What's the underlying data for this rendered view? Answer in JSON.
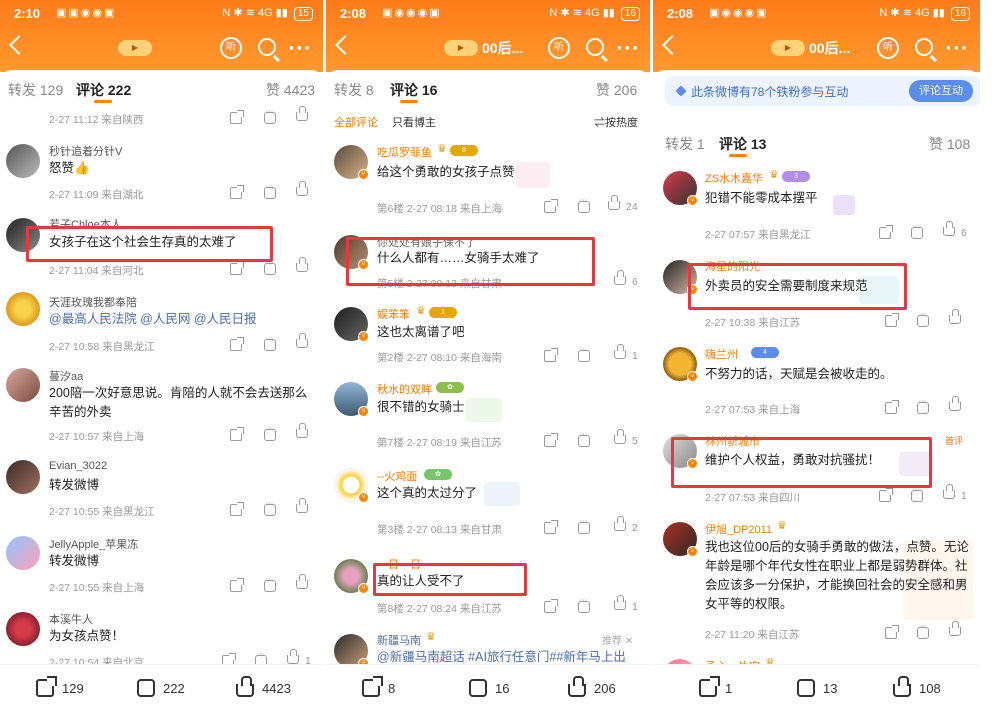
{
  "panels": [
    {
      "status": {
        "time": "2:10",
        "battery": "15"
      },
      "topic": "",
      "tabs": {
        "repost": "转发 129",
        "comments": "评论 222",
        "likes": "赞 4423"
      },
      "comments": [
        {
          "meta": "2-27 11:12  来自陕西"
        },
        {
          "user": "秒针追着分针V",
          "text": "怒赞👍",
          "meta": "2-27 11:09  来自湖北"
        },
        {
          "user": "若子Chloe本人",
          "text": "女孩子在这个社会生存真的太难了",
          "meta": "2-27 11:04  来自河北"
        },
        {
          "user": "天涯玫瑰我都奉陪",
          "text": "@最高人民法院 @人民网 @人民日报",
          "meta": "2-27 10:58  来自黑龙江"
        },
        {
          "user": "蔓汐aa",
          "text": "200陪一次好意思说。肯陪的人就不会去送那么辛苦的外卖",
          "meta": "2-27 10:57  来自上海"
        },
        {
          "user": "Evian_3022",
          "text": "转发微博",
          "meta": "2-27 10:55  来自黑龙江"
        },
        {
          "user": "JellyApple_苹果冻",
          "text": "转发微博",
          "meta": "2-27 10:55  来自上海"
        },
        {
          "user": "本溪牛人",
          "text": "为女孩点赞！",
          "meta": "2-27 10:54  来自北京",
          "likes": "1"
        }
      ],
      "bottom": {
        "share": "129",
        "comment": "222",
        "like": "4423"
      }
    },
    {
      "status": {
        "time": "2:08",
        "battery": "16"
      },
      "topic": "00后...",
      "tabs": {
        "repost": "转发 8",
        "comments": "评论 16",
        "likes": "赞 206"
      },
      "filters": {
        "all": "全部评论",
        "author": "只看博主",
        "sort": "按热度"
      },
      "comments": [
        {
          "user": "吃瓜罗菲鱼",
          "text": "给这个勇敢的女孩子点赞",
          "meta": "第6楼  2-27 08:18  来自上海",
          "likes": "24"
        },
        {
          "user": "你处处有娘子保不了",
          "text": "什么人都有……女骑手太难了",
          "meta": "第5楼  2-27 08:13  来自甘肃",
          "likes": "6"
        },
        {
          "user": "娱笨笨",
          "text": "这也太离谱了吧",
          "meta": "第2楼  2-27 08:10  来自海南",
          "likes": "1"
        },
        {
          "user": "秋水的双眸",
          "text": "很不错的女骑士",
          "meta": "第7楼  2-27 08:19  来自江苏",
          "likes": "5"
        },
        {
          "user": "--火鸡面",
          "text": "这个真的太过分了",
          "meta": "第3楼  2-27 08:13  来自甘肃",
          "likes": "2"
        },
        {
          "user": "一日一日",
          "text": "真的让人受不了",
          "meta": "第8楼  2-27 08:24  来自江苏",
          "likes": "1"
        },
        {
          "user": "新疆马南",
          "text": "@新疆马南超话 #AI旅行任意门##新年马上出发##我的家乡是强宝利##只需一张照片",
          "recommend": "推荐 ✕"
        }
      ],
      "bottom": {
        "share": "8",
        "comment": "16",
        "like": "206"
      }
    },
    {
      "status": {
        "time": "2:08",
        "battery": "16"
      },
      "topic": "00后...",
      "banner": {
        "text": "此条微博有78个铁粉参与互动",
        "button": "评论互动"
      },
      "tabs": {
        "repost": "转发 1",
        "comments": "评论 13",
        "likes": "赞 108"
      },
      "comments": [
        {
          "user": "ZS水木嘉华",
          "text": "犯错不能零成本摆平",
          "meta": "2-27 07:57  来自黑龙江",
          "likes": "6"
        },
        {
          "user": "海星的阳光",
          "text": "外卖员的安全需要制度来规范",
          "meta": "2-27 10:38  来自江苏"
        },
        {
          "user": "嗨兰州",
          "text": "不努力的话，天赋是会被收走的。",
          "meta": "2-27 07:53  来自上海"
        },
        {
          "user": "林州新城市",
          "text": "维护个人权益，勇敢对抗骚扰！",
          "meta": "2-27 07:53  来自四川",
          "likes": "1",
          "first": "首评"
        },
        {
          "user": "伊旭_DP2011",
          "text": "我也这位00后的女骑手勇敢的做法，点赞。无论年龄是哪个年代女性在职业上都是弱势群体。社会应该多一分保护，才能换回社会的安全感和男女平等的权限。",
          "meta": "2-27 11:20  来自江苏"
        },
        {
          "user": "予心一片安"
        }
      ],
      "bottom": {
        "share": "1",
        "comment": "13",
        "like": "108"
      }
    }
  ],
  "colors": {
    "accent": "#ff8200",
    "highlight": "#e8383d",
    "link": "#4a6ea8"
  }
}
